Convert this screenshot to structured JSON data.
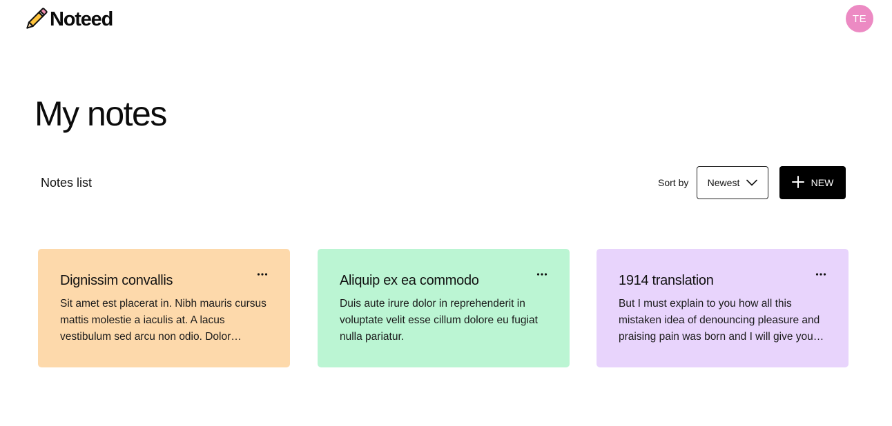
{
  "header": {
    "brand": "Noteed",
    "logo_icon": "pencil-icon",
    "avatar_initials": "TE",
    "avatar_color": "#ec8ac3"
  },
  "main": {
    "title": "My notes",
    "list_label": "Notes list",
    "sort_label": "Sort by",
    "sort_value": "Newest",
    "new_button_label": "NEW"
  },
  "notes": [
    {
      "title": "Dignissim convallis",
      "body": "Sit amet est placerat in. Nibh mauris cursus mattis molestie a iaculis at. A lacus vestibulum sed arcu non odio. Dolor morbi…",
      "color": "#fdd9ab"
    },
    {
      "title": "Aliquip ex ea commodo",
      "body": "Duis aute irure dolor in reprehenderit in voluptate velit esse cillum dolore eu fugiat nulla pariatur.",
      "color": "#bbf5d3"
    },
    {
      "title": "1914 translation",
      "body": "But I must explain to you how all this mistaken idea of denouncing pleasure and praising pain was born and I will give you …",
      "color": "#e8d4fc"
    }
  ]
}
